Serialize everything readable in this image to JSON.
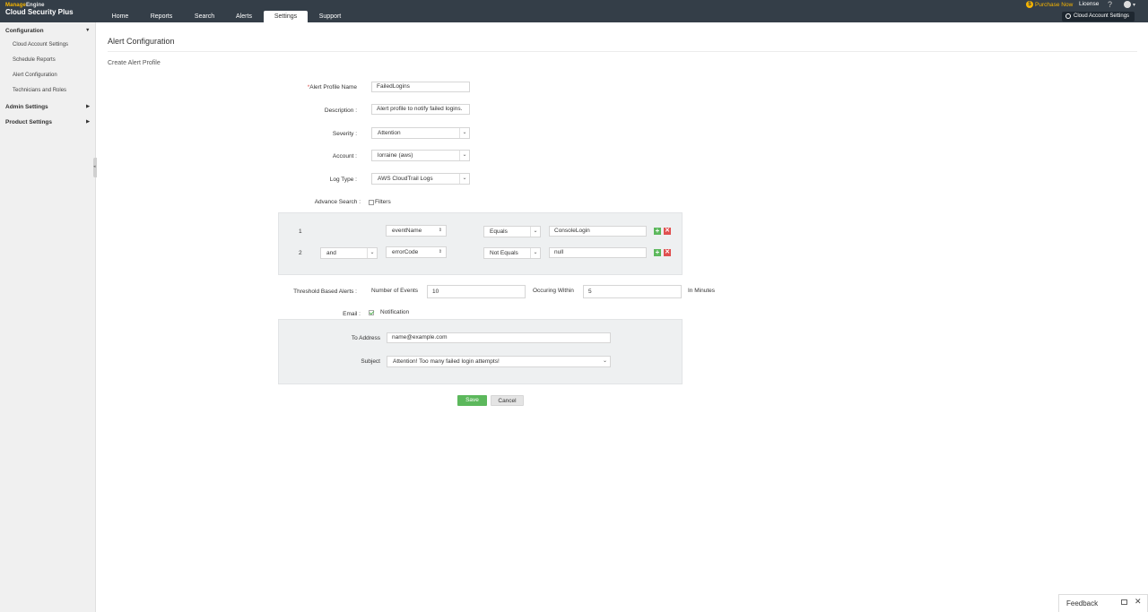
{
  "header": {
    "brand_part1": "Manage",
    "brand_part2": "Engine",
    "product": "Cloud Security Plus",
    "tabs": [
      {
        "label": "Home"
      },
      {
        "label": "Reports"
      },
      {
        "label": "Search"
      },
      {
        "label": "Alerts"
      },
      {
        "label": "Settings",
        "active": true
      },
      {
        "label": "Support"
      }
    ],
    "purchase_label": "Purchase Now",
    "license_label": "License",
    "help_glyph": "?",
    "cloud_account_settings_label": "Cloud Account Settings"
  },
  "sidebar": {
    "sections": [
      {
        "label": "Configuration",
        "expanded": true,
        "items": [
          "Cloud Account Settings",
          "Schedule Reports",
          "Alert Configuration",
          "Technicians and Roles"
        ]
      },
      {
        "label": "Admin Settings",
        "expanded": false
      },
      {
        "label": "Product Settings",
        "expanded": false
      }
    ]
  },
  "page": {
    "title": "Alert Configuration",
    "subtitle": "Create Alert Profile"
  },
  "form": {
    "profile_name_required": "*",
    "profile_name_label": "Alert Profile Name",
    "profile_name_value": "FailedLogins",
    "description_label": "Description :",
    "description_value": "Alert profile to notify failed logins.",
    "severity_label": "Severity :",
    "severity_value": "Attention",
    "account_label": "Account :",
    "account_value": "lorraine (aws)",
    "log_type_label": "Log Type :",
    "log_type_value": "AWS CloudTrail Logs",
    "advance_search_label": "Advance Search :",
    "filters_label": "Filters",
    "filters_checked": false,
    "filter_rows": [
      {
        "index": "1",
        "conjunction": "",
        "field": "eventName",
        "operator": "Equals",
        "value": "ConsoleLogin"
      },
      {
        "index": "2",
        "conjunction": "and",
        "field": "errorCode",
        "operator": "Not Equals",
        "value": "null"
      }
    ],
    "threshold_label": "Threshold Based Alerts :",
    "number_of_events_label": "Number of Events",
    "number_of_events_value": "10",
    "occurring_within_label": "Occuring Within",
    "occurring_within_value": "5",
    "in_minutes_label": "In Minutes",
    "email_label": "Email :",
    "notification_label": "Notification",
    "notification_checked": true,
    "to_address_label": "To Address",
    "to_address_value": "name@example.com",
    "subject_label": "Subject",
    "subject_value": "Attention! Too many failed login attempts!",
    "save_label": "Save",
    "cancel_label": "Cancel"
  },
  "feedback": {
    "label": "Feedback",
    "close_glyph": "✕"
  },
  "colors": {
    "topbar": "#343e48",
    "accent_yellow": "#f7b500",
    "save_green": "#5cb85c",
    "delete_red": "#e05050"
  }
}
